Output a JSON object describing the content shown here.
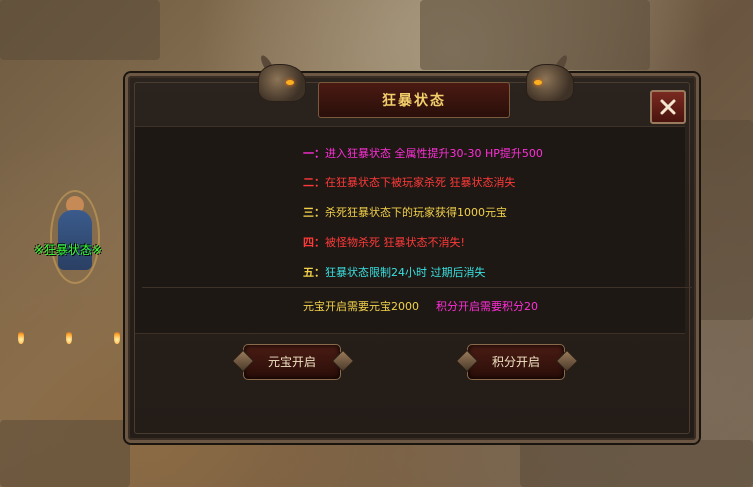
{
  "hero": {
    "status_tag": "※狂暴状态※"
  },
  "dialog": {
    "title": "狂暴状态",
    "close_icon": "close-x-icon",
    "rules": [
      {
        "num": "一：",
        "text": "进入狂暴状态 全属性提升30-30 HP提升500",
        "color": "#ff2fd8"
      },
      {
        "num": "二：",
        "text": "在狂暴状态下被玩家杀死 狂暴状态消失",
        "color": "#ff3a3a"
      },
      {
        "num": "三：",
        "text": "杀死狂暴状态下的玩家获得1000元宝",
        "color": "#f2d24a"
      },
      {
        "num": "四：",
        "text": "被怪物杀死 狂暴状态不消失!",
        "color": "#ff3a3a"
      },
      {
        "num": "五：",
        "text": "狂暴状态限制24小时 过期后消失",
        "color": "#39e0e0"
      }
    ],
    "costs": {
      "yuanbao": "元宝开启需要元宝2000",
      "jifen": "积分开启需要积分20",
      "yuanbao_color": "#f2d24a",
      "jifen_color": "#ff2fd8"
    },
    "buttons": {
      "yuanbao_open": "元宝开启",
      "jifen_open": "积分开启"
    }
  }
}
